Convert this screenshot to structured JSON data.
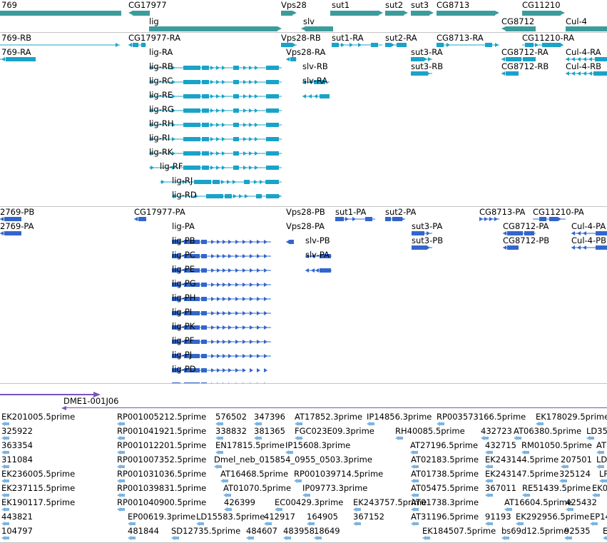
{
  "colors": {
    "gene": "#3c9c9c",
    "rna": "#1aa3c8",
    "protein": "#3366cc",
    "overlap": "#7a52c0",
    "est": "#7db3e0",
    "separator": "#c4c4c4"
  },
  "tracks": {
    "genes": {
      "items": [
        {
          "label": "769"
        },
        {
          "label": "CG17977"
        },
        {
          "label": "lig"
        },
        {
          "label": "Vps28"
        },
        {
          "label": "slv"
        },
        {
          "label": "sut1"
        },
        {
          "label": "sut2"
        },
        {
          "label": "sut3"
        },
        {
          "label": "CG8713"
        },
        {
          "label": "CG8712"
        },
        {
          "label": "CG11210"
        },
        {
          "label": "Cul-4"
        }
      ]
    },
    "transcripts": {
      "items": [
        {
          "label": "769-RB"
        },
        {
          "label": "769-RA"
        },
        {
          "label": "CG17977-RA"
        },
        {
          "label": "lig-RA"
        },
        {
          "label": "lig-RB"
        },
        {
          "label": "lig-RC"
        },
        {
          "label": "lig-RE"
        },
        {
          "label": "lig-RG"
        },
        {
          "label": "lig-RH"
        },
        {
          "label": "lig-RI"
        },
        {
          "label": "lig-RK"
        },
        {
          "label": "lig-RF"
        },
        {
          "label": "lig-RJ"
        },
        {
          "label": "lig-RD"
        },
        {
          "label": "Vps28-RB"
        },
        {
          "label": "Vps28-RA"
        },
        {
          "label": "slv-RB"
        },
        {
          "label": "slv-RA"
        },
        {
          "label": "sut1-RA"
        },
        {
          "label": "sut2-RA"
        },
        {
          "label": "sut3-RA"
        },
        {
          "label": "sut3-RB"
        },
        {
          "label": "CG8713-RA"
        },
        {
          "label": "CG8712-RA"
        },
        {
          "label": "CG8712-RB"
        },
        {
          "label": "CG11210-RA"
        },
        {
          "label": "Cul-4-RA"
        },
        {
          "label": "Cul-4-RB"
        }
      ]
    },
    "proteins": {
      "items": [
        {
          "label": "2769-PB"
        },
        {
          "label": "2769-PA"
        },
        {
          "label": "CG17977-PA"
        },
        {
          "label": "lig-PA"
        },
        {
          "label": "lig-PB"
        },
        {
          "label": "lig-PC"
        },
        {
          "label": "lig-PE"
        },
        {
          "label": "lig-PG"
        },
        {
          "label": "lig-PH"
        },
        {
          "label": "lig-PI"
        },
        {
          "label": "lig-PK"
        },
        {
          "label": "lig-PF"
        },
        {
          "label": "lig-PJ"
        },
        {
          "label": "lig-PD"
        },
        {
          "label": "Vps28-PB"
        },
        {
          "label": "Vps28-PA"
        },
        {
          "label": "slv-PB"
        },
        {
          "label": "slv-PA"
        },
        {
          "label": "sut1-PA"
        },
        {
          "label": "sut2-PA"
        },
        {
          "label": "sut3-PA"
        },
        {
          "label": "sut3-PB"
        },
        {
          "label": "CG8713-PA"
        },
        {
          "label": "CG8712-PA"
        },
        {
          "label": "CG8712-PB"
        },
        {
          "label": "CG11210-PA"
        },
        {
          "label": "Cul-4-PA"
        },
        {
          "label": "Cul-4-PB"
        }
      ]
    },
    "overlaps": {
      "items": [
        {
          "label": "DME1-001J06"
        }
      ]
    },
    "ests": {
      "items": [
        {
          "label": "EK201005.5prime"
        },
        {
          "label": "RP001005212.5prime"
        },
        {
          "label": "576502"
        },
        {
          "label": "347396"
        },
        {
          "label": "AT17852.3prime"
        },
        {
          "label": "IP14856.3prime"
        },
        {
          "label": "RP003573166.5prime"
        },
        {
          "label": "EK178029.5prime"
        },
        {
          "label": "325922"
        },
        {
          "label": "RP001041921.5prime"
        },
        {
          "label": "338832"
        },
        {
          "label": "381365"
        },
        {
          "label": "FGC023E09.3prime"
        },
        {
          "label": "RH40085.5prime"
        },
        {
          "label": "432723"
        },
        {
          "label": "AT06380.5prime"
        },
        {
          "label": "LD35"
        },
        {
          "label": "363354"
        },
        {
          "label": "RP001012201.5prime"
        },
        {
          "label": "EN17815.5prime"
        },
        {
          "label": "IP15608.3prime"
        },
        {
          "label": "AT27196.5prime"
        },
        {
          "label": "432715"
        },
        {
          "label": "RM01050.5prime"
        },
        {
          "label": "AT"
        },
        {
          "label": "311084"
        },
        {
          "label": "RP001007352.5prime"
        },
        {
          "label": "Dmel_neb_015854_0955_0503.3prime"
        },
        {
          "label": "AT02183.5prime"
        },
        {
          "label": "EK243144.5prime"
        },
        {
          "label": "207501"
        },
        {
          "label": "LD"
        },
        {
          "label": "EK236005.5prime"
        },
        {
          "label": "RP001031036.5prime"
        },
        {
          "label": "AT16468.5prime"
        },
        {
          "label": "RP001039714.5prime"
        },
        {
          "label": "AT01738.5prime"
        },
        {
          "label": "EK243147.5prime"
        },
        {
          "label": "325124"
        },
        {
          "label": "LP"
        },
        {
          "label": "EK237115.5prime"
        },
        {
          "label": "RP001039831.5prime"
        },
        {
          "label": "AT01070.5prime"
        },
        {
          "label": "IP09773.3prime"
        },
        {
          "label": "AT05475.5prime"
        },
        {
          "label": "367011"
        },
        {
          "label": "RE51439.5prime"
        },
        {
          "label": "EK0"
        },
        {
          "label": "EK190117.5prime"
        },
        {
          "label": "RP001040900.5prime"
        },
        {
          "label": "426399"
        },
        {
          "label": "EC00429.3prime"
        },
        {
          "label": "EK243757.5prime"
        },
        {
          "label": "AT01738.3prime"
        },
        {
          "label": "AT16604.5prime"
        },
        {
          "label": "425432"
        },
        {
          "label": "443821"
        },
        {
          "label": "EP00619.3prime"
        },
        {
          "label": "LD15583.5prime"
        },
        {
          "label": "412917"
        },
        {
          "label": "164905"
        },
        {
          "label": "367152"
        },
        {
          "label": "AT31196.5prime"
        },
        {
          "label": "91193"
        },
        {
          "label": "EK292956.5prime"
        },
        {
          "label": "EP14"
        },
        {
          "label": "104797"
        },
        {
          "label": "481844"
        },
        {
          "label": "SD12735.5prime"
        },
        {
          "label": "484607"
        },
        {
          "label": "483958"
        },
        {
          "label": "18649"
        },
        {
          "label": "EK184507.5prime"
        },
        {
          "label": "bs69d12.5prime"
        },
        {
          "label": "92535"
        },
        {
          "label": "EK"
        }
      ]
    }
  }
}
